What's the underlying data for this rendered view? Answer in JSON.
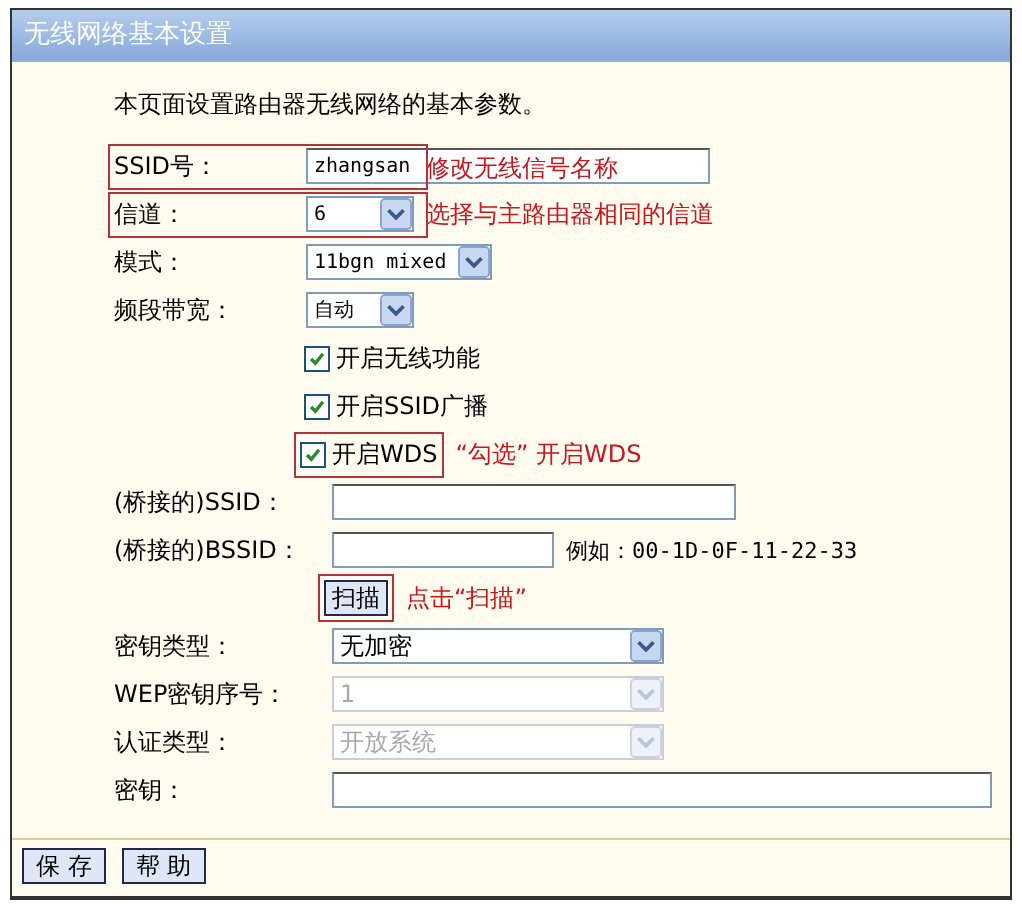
{
  "window": {
    "title": "无线网络基本设置"
  },
  "intro": "本页面设置路由器无线网络的基本参数。",
  "basic_fields": [
    {
      "kind": "text",
      "label": "SSID号：",
      "value": "zhangsan",
      "note": "修改无线信号名称",
      "highlighted": true
    },
    {
      "kind": "select",
      "label": "信道：",
      "value": "6",
      "note": "选择与主路由器相同的信道",
      "highlighted": true
    },
    {
      "kind": "select",
      "label": "模式：",
      "value": "11bgn mixed",
      "highlighted": false
    },
    {
      "kind": "select",
      "label": "频段带宽：",
      "value": "自动",
      "highlighted": false
    }
  ],
  "options": [
    {
      "label": "开启无线功能",
      "checked": true,
      "highlighted": false
    },
    {
      "label": "开启SSID广播",
      "checked": true,
      "highlighted": false
    },
    {
      "label": "开启WDS",
      "checked": true,
      "highlighted": true,
      "note": "“勾选” 开启WDS"
    }
  ],
  "bridge_fields": [
    {
      "label": "(桥接的)SSID："
    },
    {
      "label": "(桥接的)BSSID：",
      "hint": "例如：00-1D-0F-11-22-33"
    }
  ],
  "scan_button": {
    "label": "扫描",
    "highlighted": true,
    "note": "点击“扫描”"
  },
  "security_fields": [
    {
      "kind": "select",
      "label": "密钥类型：",
      "value": "无加密",
      "disabled": false
    },
    {
      "kind": "select",
      "label": "WEP密钥序号：",
      "value": "1",
      "disabled": true
    },
    {
      "kind": "select",
      "label": "认证类型：",
      "value": "开放系统",
      "disabled": true
    },
    {
      "kind": "text",
      "label": "密钥："
    }
  ],
  "buttons": [
    "保 存",
    "帮 助"
  ]
}
